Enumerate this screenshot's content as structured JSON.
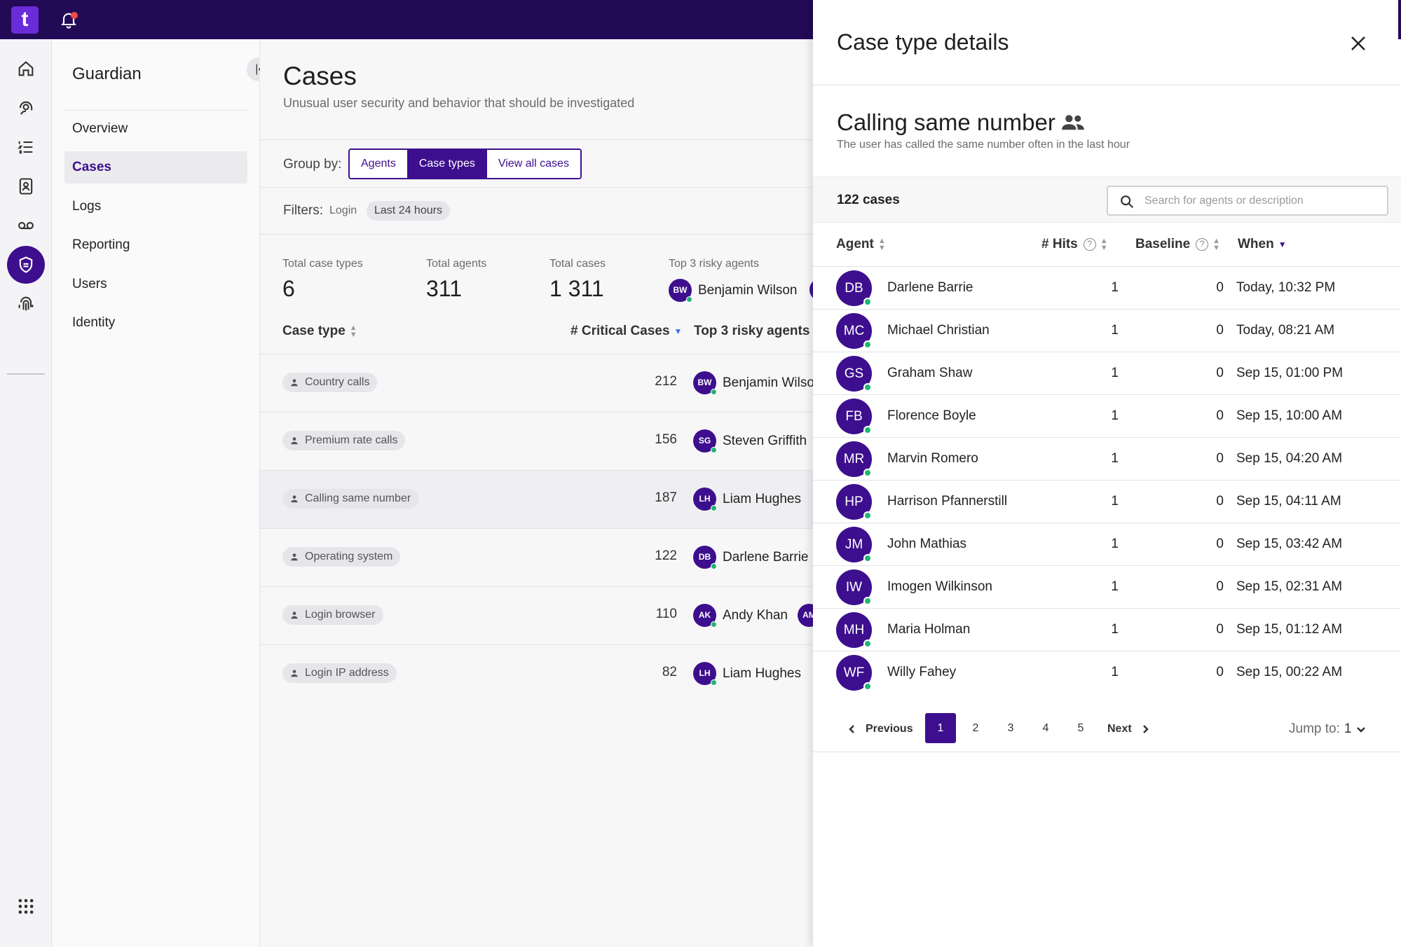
{
  "app": {
    "logo_letter": "t"
  },
  "sidebar": {
    "title": "Guardian",
    "items": [
      {
        "label": "Overview",
        "active": false
      },
      {
        "label": "Cases",
        "active": true
      },
      {
        "label": "Logs",
        "active": false
      },
      {
        "label": "Reporting",
        "active": false
      },
      {
        "label": "Users",
        "active": false
      },
      {
        "label": "Identity",
        "active": false
      }
    ]
  },
  "main": {
    "title": "Cases",
    "subtitle": "Unusual user security and behavior that should be investigated",
    "group_by": {
      "label": "Group by:",
      "options": [
        "Agents",
        "Case types",
        "View all cases"
      ],
      "selected": "Case types"
    },
    "filters": {
      "label": "Filters:",
      "plain": "Login",
      "chip": "Last 24 hours"
    },
    "stats": [
      {
        "label": "Total case types",
        "value": "6"
      },
      {
        "label": "Total agents",
        "value": "311"
      },
      {
        "label": "Total cases",
        "value": "1 311"
      },
      {
        "label": "Top 3 risky agents",
        "agent_initials": "BW",
        "agent_name": "Benjamin Wilson"
      }
    ],
    "table": {
      "columns": [
        "Case type",
        "# Critical Cases",
        "Top 3 risky agents"
      ],
      "rows": [
        {
          "case_type": "Country calls",
          "count": "212",
          "initials": "BW",
          "agent": "Benjamin Wilson"
        },
        {
          "case_type": "Premium rate calls",
          "count": "156",
          "initials": "SG",
          "agent": "Steven Griffith"
        },
        {
          "case_type": "Calling same number",
          "count": "187",
          "initials": "LH",
          "agent": "Liam Hughes"
        },
        {
          "case_type": "Operating system",
          "count": "122",
          "initials": "DB",
          "agent": "Darlene Barrie"
        },
        {
          "case_type": "Login browser",
          "count": "110",
          "initials": "AK",
          "agent": "Andy Khan",
          "extra_initials": "AM"
        },
        {
          "case_type": "Login IP address",
          "count": "82",
          "initials": "LH",
          "agent": "Liam Hughes"
        }
      ]
    }
  },
  "panel": {
    "title": "Case type details",
    "case_title": "Calling same number",
    "case_description": "The user has called the same number often in the last hour",
    "count_label": "122 cases",
    "search_placeholder": "Search for agents or description",
    "columns": {
      "agent": "Agent",
      "hits": "# Hits",
      "baseline": "Baseline",
      "when": "When"
    },
    "rows": [
      {
        "initials": "DB",
        "name": "Darlene Barrie",
        "hits": "1",
        "baseline": "0",
        "when": "Today, 10:32 PM"
      },
      {
        "initials": "MC",
        "name": "Michael Christian",
        "hits": "1",
        "baseline": "0",
        "when": "Today, 08:21 AM"
      },
      {
        "initials": "GS",
        "name": "Graham Shaw",
        "hits": "1",
        "baseline": "0",
        "when": "Sep 15, 01:00 PM"
      },
      {
        "initials": "FB",
        "name": "Florence Boyle",
        "hits": "1",
        "baseline": "0",
        "when": "Sep 15, 10:00 AM"
      },
      {
        "initials": "MR",
        "name": "Marvin Romero",
        "hits": "1",
        "baseline": "0",
        "when": "Sep 15, 04:20 AM"
      },
      {
        "initials": "HP",
        "name": "Harrison Pfannerstill",
        "hits": "1",
        "baseline": "0",
        "when": "Sep 15, 04:11 AM"
      },
      {
        "initials": "JM",
        "name": "John Mathias",
        "hits": "1",
        "baseline": "0",
        "when": "Sep 15, 03:42 AM"
      },
      {
        "initials": "IW",
        "name": "Imogen Wilkinson",
        "hits": "1",
        "baseline": "0",
        "when": "Sep 15, 02:31 AM"
      },
      {
        "initials": "MH",
        "name": "Maria Holman",
        "hits": "1",
        "baseline": "0",
        "when": "Sep 15, 01:12 AM"
      },
      {
        "initials": "WF",
        "name": "Willy Fahey",
        "hits": "1",
        "baseline": "0",
        "when": "Sep 15, 00:22 AM"
      }
    ],
    "pagination": {
      "previous": "Previous",
      "pages": [
        "1",
        "2",
        "3",
        "4",
        "5"
      ],
      "current": "1",
      "next": "Next",
      "jump_label": "Jump to:",
      "jump_value": "1"
    }
  },
  "colors": {
    "brand_dark": "#220a57",
    "accent": "#3d0f8e",
    "online": "#22b573",
    "notification": "#ef4b3f"
  },
  "icons": {
    "rail": [
      "home-icon",
      "support-agent-icon",
      "list-icon",
      "contacts-icon",
      "voicemail-icon",
      "shield-icon",
      "fingerprint-icon",
      "apps-grid-icon"
    ]
  }
}
